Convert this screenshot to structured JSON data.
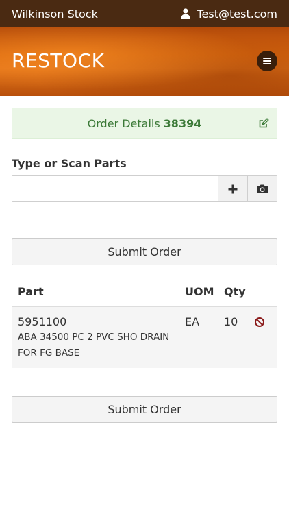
{
  "topbar": {
    "brand": "Wilkinson Stock",
    "user": "Test@test.com"
  },
  "banner": {
    "title": "RESTOCK"
  },
  "order_details": {
    "label": "Order Details",
    "number": "38394"
  },
  "parts_input": {
    "label": "Type or Scan Parts",
    "value": "",
    "placeholder": ""
  },
  "submit_label": "Submit Order",
  "table": {
    "headers": [
      "Part",
      "UOM",
      "Qty"
    ],
    "rows": [
      {
        "part": "5951100",
        "description": "ABA 34500 PC 2 PVC SHO DRAIN FOR FG BASE",
        "uom": "EA",
        "qty": "10"
      }
    ]
  },
  "icons": {
    "user": "user-icon",
    "menu": "hamburger-icon",
    "edit": "edit-icon",
    "add": "plus-icon",
    "scan": "camera-icon",
    "remove": "ban-icon"
  },
  "colors": {
    "topbar": "#4a2a12",
    "banner": "#d9670f",
    "success_bg": "#eaf6e6",
    "success_text": "#3c7a38",
    "remove": "#8b1a1a"
  }
}
